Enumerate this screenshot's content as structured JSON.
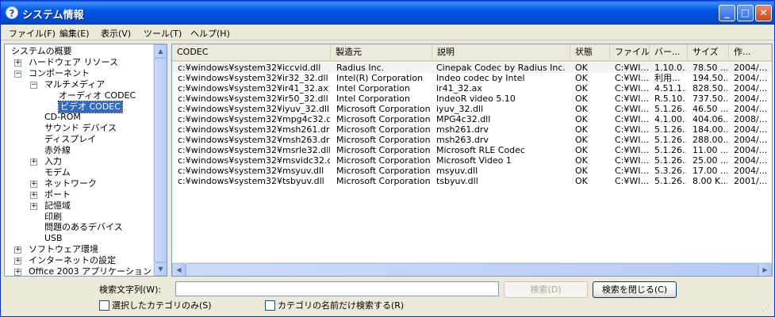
{
  "window": {
    "title": "システム情報",
    "icon_glyph": "?"
  },
  "menu": [
    {
      "label": "ファイル(F)"
    },
    {
      "label": "編集(E)"
    },
    {
      "label": "表示(V)"
    },
    {
      "label": "ツール(T)"
    },
    {
      "label": "ヘルプ(H)"
    }
  ],
  "tree": {
    "items": [
      {
        "label": "システムの概要",
        "expander": ""
      },
      {
        "label": "ハードウェア リソース",
        "expander": "+"
      },
      {
        "label": "コンポーネント",
        "expander": "−"
      },
      {
        "label": "マルチメディア",
        "expander": "−"
      },
      {
        "label": "オーディオ CODEC",
        "expander": ""
      },
      {
        "label": "ビデオ CODEC",
        "expander": "",
        "selected": true
      },
      {
        "label": "CD-ROM",
        "expander": ""
      },
      {
        "label": "サウンド デバイス",
        "expander": ""
      },
      {
        "label": "ディスプレイ",
        "expander": ""
      },
      {
        "label": "赤外線",
        "expander": ""
      },
      {
        "label": "入力",
        "expander": "+"
      },
      {
        "label": "モデム",
        "expander": ""
      },
      {
        "label": "ネットワーク",
        "expander": "+"
      },
      {
        "label": "ポート",
        "expander": "+"
      },
      {
        "label": "記憶域",
        "expander": "+"
      },
      {
        "label": "印刷",
        "expander": ""
      },
      {
        "label": "問題のあるデバイス",
        "expander": ""
      },
      {
        "label": "USB",
        "expander": ""
      },
      {
        "label": "ソフトウェア環境",
        "expander": "+"
      },
      {
        "label": "インターネットの設定",
        "expander": "+"
      },
      {
        "label": "Office 2003 アプリケーション",
        "expander": "+"
      }
    ]
  },
  "list": {
    "columns": [
      "CODEC",
      "製造元",
      "説明",
      "状態",
      "ファイル",
      "バー...",
      "サイズ",
      "作..."
    ],
    "rows": [
      [
        "c:¥windows¥system32¥iccvid.dll",
        "Radius Inc.",
        "Cinepak Codec by Radius Inc.",
        "OK",
        "C:¥WI...",
        "1.10.0...",
        "78.50 ...",
        "2004/..."
      ],
      [
        "c:¥windows¥system32¥ir32_32.dll",
        "Intel(R) Corporation",
        "Indeo codec by Intel",
        "OK",
        "C:¥WI...",
        "利用...",
        "194.50...",
        "2004/..."
      ],
      [
        "c:¥windows¥system32¥ir41_32.ax",
        "Intel Corporation",
        "ir41_32.ax",
        "OK",
        "C:¥WI...",
        "4.51.1...",
        "828.50...",
        "2004/..."
      ],
      [
        "c:¥windows¥system32¥ir50_32.dll",
        "Intel Corporation",
        "IndeoR video 5.10",
        "OK",
        "C:¥WI...",
        "R.5.10...",
        "737.50...",
        "2004/..."
      ],
      [
        "c:¥windows¥system32¥iyuv_32.dll",
        "Microsoft Corporation",
        "iyuv_32.dll",
        "OK",
        "C:¥WI...",
        "5.1.26...",
        "46.50 ...",
        "2004/..."
      ],
      [
        "c:¥windows¥system32¥mpg4c32.dll",
        "Microsoft Corporation",
        "MPG4c32.dll",
        "OK",
        "C:¥WI...",
        "4.1.00...",
        "404.06...",
        "2008/..."
      ],
      [
        "c:¥windows¥system32¥msh261.drv",
        "Microsoft Corporation",
        "msh261.drv",
        "OK",
        "C:¥WI...",
        "5.1.26...",
        "184.00...",
        "2004/..."
      ],
      [
        "c:¥windows¥system32¥msh263.drv",
        "Microsoft Corporation",
        "msh263.drv",
        "OK",
        "C:¥WI...",
        "5.1.26...",
        "288.00...",
        "2004/..."
      ],
      [
        "c:¥windows¥system32¥msrle32.dll",
        "Microsoft Corporation",
        "Microsoft RLE Codec",
        "OK",
        "C:¥WI...",
        "5.1.26...",
        "11.00 ...",
        "2004/..."
      ],
      [
        "c:¥windows¥system32¥msvidc32.dll",
        "Microsoft Corporation",
        "Microsoft Video 1",
        "OK",
        "C:¥WI...",
        "5.1.26...",
        "25.00 ...",
        "2004/..."
      ],
      [
        "c:¥windows¥system32¥msyuv.dll",
        "Microsoft Corporation",
        "msyuv.dll",
        "OK",
        "C:¥WI...",
        "5.3.26...",
        "17.00 ...",
        "2004/..."
      ],
      [
        "c:¥windows¥system32¥tsbyuv.dll",
        "Microsoft Corporation",
        "tsbyuv.dll",
        "OK",
        "C:¥WI...",
        "5.1.26...",
        "8.00 K...",
        "2001/..."
      ]
    ]
  },
  "search": {
    "label": "検索文字列(W):",
    "value": "",
    "find_button": "検索(D)",
    "close_find_button": "検索を閉じる(C)",
    "check_selected_category": "選択したカテゴリのみ(S)",
    "check_category_names": "カテゴリの名前だけ検索する(R)"
  }
}
